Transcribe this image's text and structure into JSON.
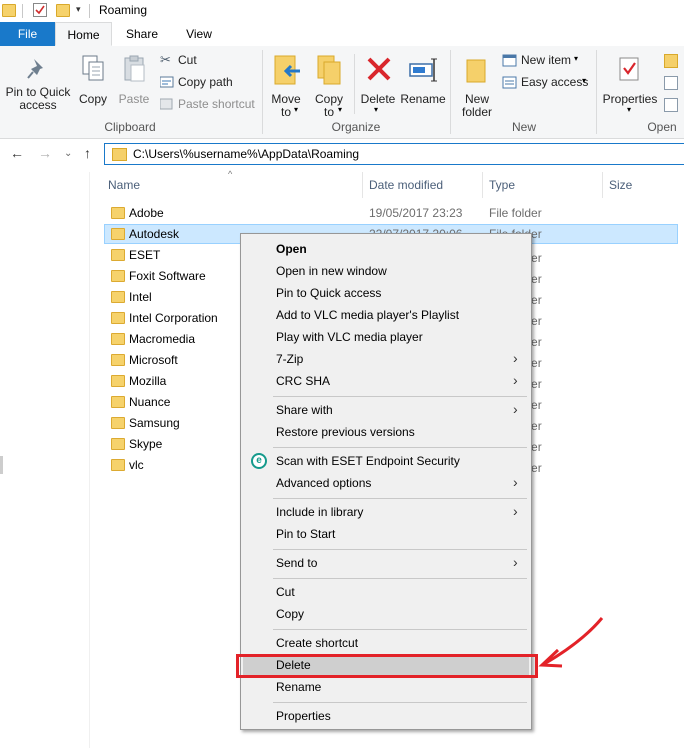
{
  "window": {
    "title": "Roaming"
  },
  "tabs": {
    "file": "File",
    "home": "Home",
    "share": "Share",
    "view": "View"
  },
  "ribbon": {
    "clipboard": {
      "pin": "Pin to Quick access",
      "pin_line1": "Pin to Quick",
      "pin_line2": "access",
      "copy": "Copy",
      "paste": "Paste",
      "cut": "Cut",
      "copy_path": "Copy path",
      "paste_shortcut": "Paste shortcut",
      "label": "Clipboard"
    },
    "organize": {
      "move_to_line1": "Move",
      "move_to_line2": "to",
      "copy_to_line1": "Copy",
      "copy_to_line2": "to",
      "delete": "Delete",
      "rename": "Rename",
      "label": "Organize"
    },
    "new": {
      "new_folder_line1": "New",
      "new_folder_line2": "folder",
      "new_item": "New item",
      "easy_access": "Easy access",
      "label": "New"
    },
    "open": {
      "properties": "Properties",
      "label": "Open"
    }
  },
  "address": {
    "path": "C:\\Users\\%username%\\AppData\\Roaming"
  },
  "columns": {
    "name": "Name",
    "date_modified": "Date modified",
    "type": "Type",
    "size": "Size"
  },
  "files": [
    {
      "name": "Adobe",
      "date": "19/05/2017 23:23",
      "type": "File folder"
    },
    {
      "name": "Autodesk",
      "date": "22/07/2017 20:06",
      "type": "File folder"
    },
    {
      "name": "ESET",
      "date": "",
      "type": ""
    },
    {
      "name": "Foxit Software",
      "date": "",
      "type": ""
    },
    {
      "name": "Intel",
      "date": "",
      "type": ""
    },
    {
      "name": "Intel Corporation",
      "date": "",
      "type": ""
    },
    {
      "name": "Macromedia",
      "date": "",
      "type": ""
    },
    {
      "name": "Microsoft",
      "date": "",
      "type": ""
    },
    {
      "name": "Mozilla",
      "date": "",
      "type": ""
    },
    {
      "name": "Nuance",
      "date": "",
      "type": ""
    },
    {
      "name": "Samsung",
      "date": "",
      "type": ""
    },
    {
      "name": "Skype",
      "date": "",
      "type": ""
    },
    {
      "name": "vlc",
      "date": "",
      "type": ""
    }
  ],
  "context_menu": {
    "open": "Open",
    "open_new_window": "Open in new window",
    "pin_quick": "Pin to Quick access",
    "vlc_playlist": "Add to VLC media player's Playlist",
    "vlc_play": "Play with VLC media player",
    "seven_zip": "7-Zip",
    "crc_sha": "CRC SHA",
    "share_with": "Share with",
    "restore": "Restore previous versions",
    "eset_scan": "Scan with ESET Endpoint Security",
    "advanced": "Advanced options",
    "include_library": "Include in library",
    "pin_start": "Pin to Start",
    "send_to": "Send to",
    "cut": "Cut",
    "copy": "Copy",
    "create_shortcut": "Create shortcut",
    "delete": "Delete",
    "rename": "Rename",
    "properties": "Properties",
    "eset_glyph": "e"
  },
  "colors": {
    "accent": "#1979ca",
    "selection": "#cce8ff",
    "highlight_box": "#e32228"
  }
}
